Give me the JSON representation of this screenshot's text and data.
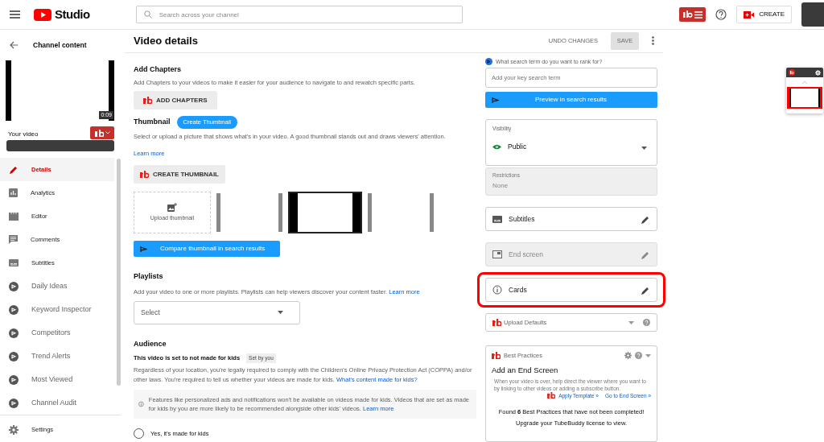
{
  "header": {
    "app_name": "Studio",
    "search_placeholder": "Search across your channel",
    "create_label": "CREATE"
  },
  "sidebar": {
    "back_title": "Channel content",
    "video_duration": "0:09",
    "video_label": "Your video",
    "nav": [
      {
        "label": "Details",
        "kind": "details",
        "selected": true
      },
      {
        "label": "Analytics",
        "kind": "analytics",
        "selected": false
      },
      {
        "label": "Editor",
        "kind": "editor",
        "selected": false
      },
      {
        "label": "Comments",
        "kind": "comments",
        "selected": false
      },
      {
        "label": "Subtitles",
        "kind": "subtitles",
        "selected": false
      },
      {
        "label": "Daily Ideas",
        "kind": "addon",
        "selected": false
      },
      {
        "label": "Keyword Inspector",
        "kind": "addon",
        "selected": false
      },
      {
        "label": "Competitors",
        "kind": "addon",
        "selected": false
      },
      {
        "label": "Trend Alerts",
        "kind": "addon",
        "selected": false
      },
      {
        "label": "Most Viewed",
        "kind": "addon",
        "selected": false
      },
      {
        "label": "Channel Audit",
        "kind": "addon",
        "selected": false
      }
    ],
    "settings_label": "Settings"
  },
  "page": {
    "title": "Video details",
    "undo_label": "UNDO CHANGES",
    "save": {
      "label": "SAVE",
      "disabled": true
    }
  },
  "chapters": {
    "title": "Add Chapters",
    "description": "Add Chapters to your videos to make it easier for your audience to navigate to and rewatch specific parts.",
    "button": "ADD CHAPTERS"
  },
  "thumbnail": {
    "title": "Thumbnail",
    "create_chip": "Create Thumbnail",
    "description": "Select or upload a picture that shows what's in your video. A good thumbnail stands out and draws viewers' attention.",
    "learn_more": "Learn more",
    "button": "CREATE THUMBNAIL",
    "upload_label": "Upload thumbnail",
    "options": [
      {
        "selected": false
      },
      {
        "selected": true
      },
      {
        "selected": false
      }
    ],
    "compare_button": "Compare thumbnail in search results"
  },
  "playlists": {
    "title": "Playlists",
    "description": "Add your video to one or more playlists. Playlists can help viewers discover your content faster.",
    "learn_more": "Learn more",
    "select_placeholder": "Select"
  },
  "audience": {
    "title": "Audience",
    "status": "This video is set to not made for kids",
    "set_by": "Set by you",
    "description": "Regardless of your location, you're legally required to comply with the Children's Online Privacy Protection Act (COPPA) and/or other laws. You're required to tell us whether your videos are made for kids.",
    "link": "What's content made for kids?",
    "notice": "Features like personalized ads and notifications won't be available on videos made for kids. Videos that are set as made for kids by you are more likely to be recommended alongside other kids' videos.",
    "notice_link": "Learn more",
    "options": [
      {
        "label": "Yes, it's made for kids",
        "selected": false
      }
    ]
  },
  "right": {
    "search_prompt": "What search term do you want to rank for?",
    "search_placeholder": "Add your key search term",
    "preview_button": "Preview in search results",
    "visibility": {
      "label": "Visibility",
      "value": "Public"
    },
    "restrictions": {
      "label": "Restrictions",
      "value": "None",
      "disabled": true
    },
    "panels": [
      {
        "label": "Subtitles",
        "kind": "subtitles",
        "disabled": false,
        "highlighted": false
      },
      {
        "label": "End screen",
        "kind": "endscreen",
        "disabled": true,
        "highlighted": false
      },
      {
        "label": "Cards",
        "kind": "cards",
        "disabled": false,
        "highlighted": true
      }
    ],
    "upload_defaults": "Upload Defaults",
    "best_practices": {
      "title": "Best Practices",
      "heading": "Add an End Screen",
      "description": "When your video is over, help direct the viewer where you want to by linking to other videos or adding a subscribe button.",
      "apply_link": "Apply Template »",
      "goto_link": "Go to End Screen »",
      "found": "Found **6** Best Practices that have not been completed!",
      "upgrade": "Upgrade your TubeBuddy license to view."
    }
  }
}
